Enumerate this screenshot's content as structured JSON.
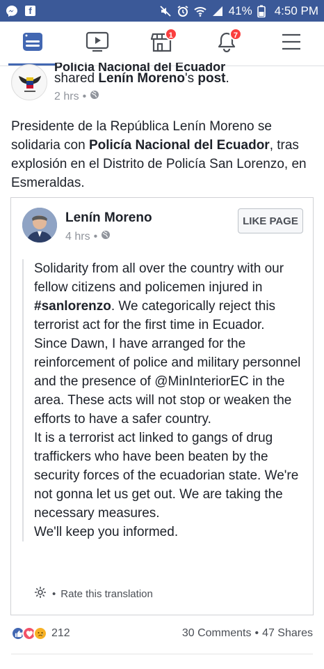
{
  "status_bar": {
    "battery": "41%",
    "time": "4:50 PM"
  },
  "nav": {
    "items": [
      {
        "name": "news-feed",
        "badge": ""
      },
      {
        "name": "watch",
        "badge": ""
      },
      {
        "name": "marketplace",
        "badge": "1"
      },
      {
        "name": "notifications",
        "badge": "7"
      },
      {
        "name": "menu",
        "badge": ""
      }
    ]
  },
  "post": {
    "page_name": "Policía Nacional del Ecuador",
    "shared_prefix": "shared",
    "shared_author": "Lenín Moreno",
    "shared_suffix": "'s",
    "shared_object": "post",
    "time": "2 hrs",
    "text_part1": "Presidente de la República Lenín Moreno se solidaria con ",
    "text_bold": "Policía Nacional del Ecuador",
    "text_part2": ", tras explosión en el Distrito de Policía San Lorenzo, en Esmeraldas."
  },
  "card": {
    "author": "Lenín Moreno",
    "time": "4 hrs",
    "like_button": "LIKE PAGE",
    "quote_a1": "Solidarity from all over the country with our fellow citizens and policemen injured in ",
    "quote_hashtag": "#sanlorenzo",
    "quote_a2": ". We categorically reject this terrorist act for the first time in Ecuador.",
    "quote_b": "Since Dawn, I have arranged for the reinforcement of police and military personnel and the presence of @MinInteriorEC in the area. These acts will not stop or weaken the efforts to have a safer country.",
    "quote_c": "It is a terrorist act linked to gangs of drug traffickers who have been beaten by the security forces of the ecuadorian state. We're not gonna let us get out. We are taking the necessary measures.",
    "quote_d": "We'll keep you informed.",
    "translation_link": "Rate this translation"
  },
  "footer": {
    "reaction_count": "212",
    "comments": "30 Comments",
    "shares": "47 Shares",
    "separator": "•"
  },
  "colors": {
    "brand": "#3b5998",
    "accent": "#4267b2",
    "badge": "#fa3e3e"
  }
}
